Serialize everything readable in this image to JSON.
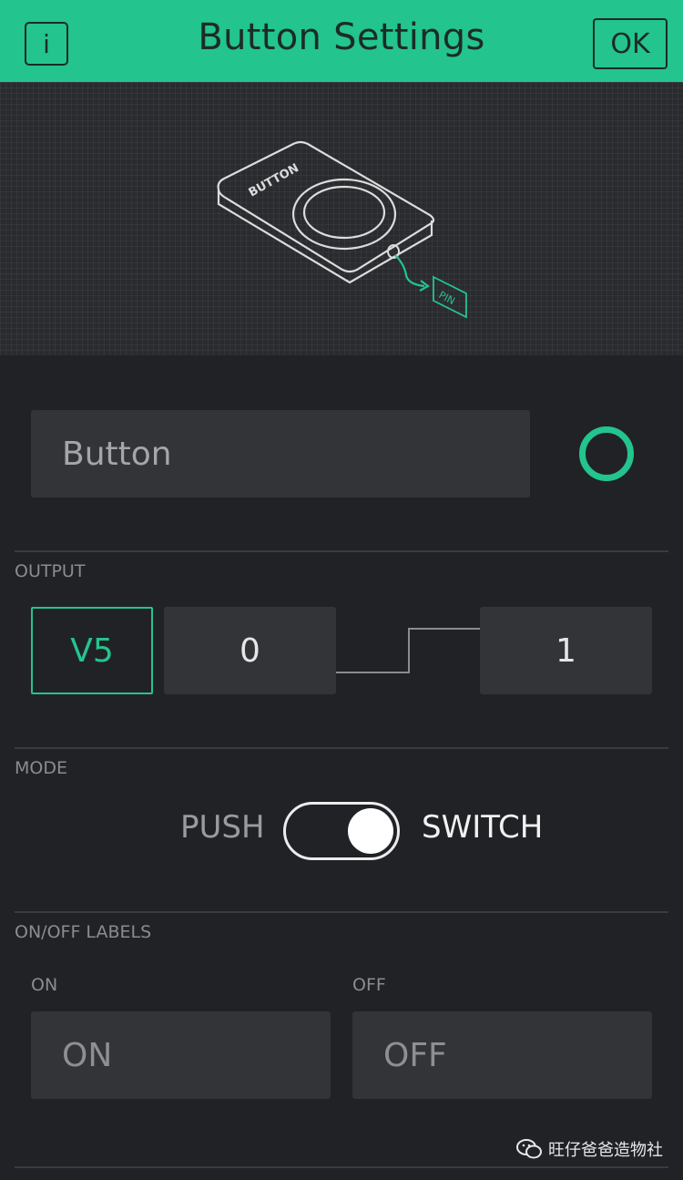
{
  "header": {
    "title": "Button Settings",
    "info_label": "i",
    "ok_label": "OK",
    "background_color": "#23c48e"
  },
  "illustration": {
    "device_label": "BUTTON",
    "pin_label": "PIN"
  },
  "name_field": {
    "value": "Button",
    "color_indicator": "#23c48e"
  },
  "output": {
    "section_label": "OUTPUT",
    "pin": "V5",
    "off_value": "0",
    "on_value": "1"
  },
  "mode": {
    "section_label": "MODE",
    "push_label": "PUSH",
    "switch_label": "SWITCH",
    "selected": "SWITCH"
  },
  "labels": {
    "section_label": "ON/OFF LABELS",
    "on_label": "ON",
    "off_label": "OFF",
    "on_placeholder": "ON",
    "off_placeholder": "OFF"
  },
  "watermark": {
    "text": "旺仔爸爸造物社"
  },
  "colors": {
    "accent": "#23c48e",
    "background": "#212226",
    "field": "#333438"
  }
}
